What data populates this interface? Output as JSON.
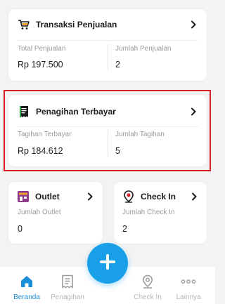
{
  "colors": {
    "accent": "#1aa0e8",
    "active_nav": "#1a8fd8",
    "inactive_nav": "#b7b7b7",
    "highlight_border": "#d61f26"
  },
  "sales_card": {
    "title": "Transaksi Penjualan",
    "icon": "shopping-cart-icon",
    "total_label": "Total Penjualan",
    "total_value": "Rp 197.500",
    "count_label": "Jumlah Penjualan",
    "count_value": "2"
  },
  "billing_card": {
    "title": "Penagihan Terbayar",
    "icon": "receipt-icon",
    "paid_label": "Tagihan Terbayar",
    "paid_value": "Rp 184.612",
    "count_label": "Jumlah Tagihan",
    "count_value": "5"
  },
  "outlet_card": {
    "title": "Outlet",
    "icon": "store-icon",
    "count_label": "Jumlah Outlet",
    "count_value": "0"
  },
  "checkin_card": {
    "title": "Check In",
    "icon": "location-pin-icon",
    "count_label": "Jumlah Check In",
    "count_value": "2"
  },
  "fab": {
    "icon": "plus-icon"
  },
  "bottom_nav": {
    "items": [
      {
        "label": "Beranda",
        "icon": "home-icon",
        "active": true
      },
      {
        "label": "Penagihan",
        "icon": "invoice-icon",
        "active": false
      },
      {
        "label": "Check In",
        "icon": "location-pin-icon",
        "active": false
      },
      {
        "label": "Lainnya",
        "icon": "more-dots-icon",
        "active": false
      }
    ]
  }
}
